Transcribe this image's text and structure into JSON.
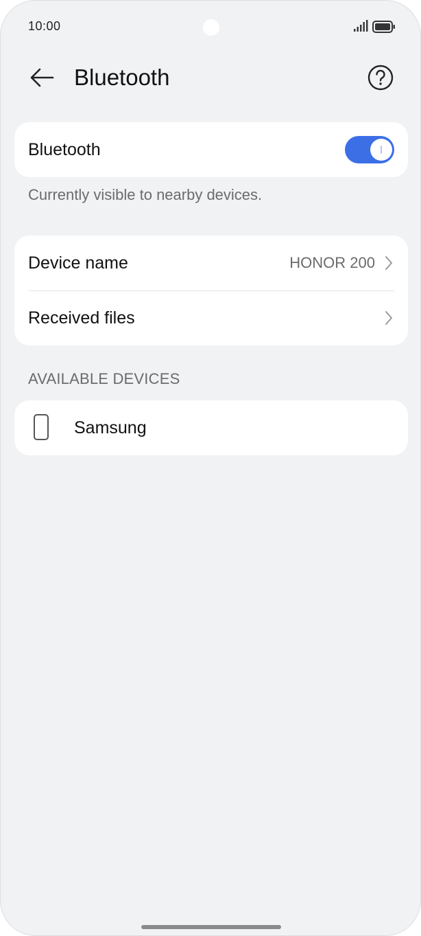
{
  "status_bar": {
    "time": "10:00",
    "signal_icon": "signal-bars-icon",
    "battery_icon": "battery-full-icon"
  },
  "header": {
    "back_icon": "arrow-left-icon",
    "title": "Bluetooth",
    "help_icon": "question-circle-icon"
  },
  "bluetooth_toggle": {
    "label": "Bluetooth",
    "enabled": true,
    "accent_color": "#3c6fe6"
  },
  "visibility_hint": "Currently visible to nearby devices.",
  "settings": {
    "device_name": {
      "label": "Device name",
      "value": "HONOR 200"
    },
    "received_files": {
      "label": "Received files"
    }
  },
  "available_devices": {
    "header": "AVAILABLE DEVICES",
    "items": [
      {
        "name": "Samsung",
        "icon": "phone-device-icon"
      }
    ]
  }
}
